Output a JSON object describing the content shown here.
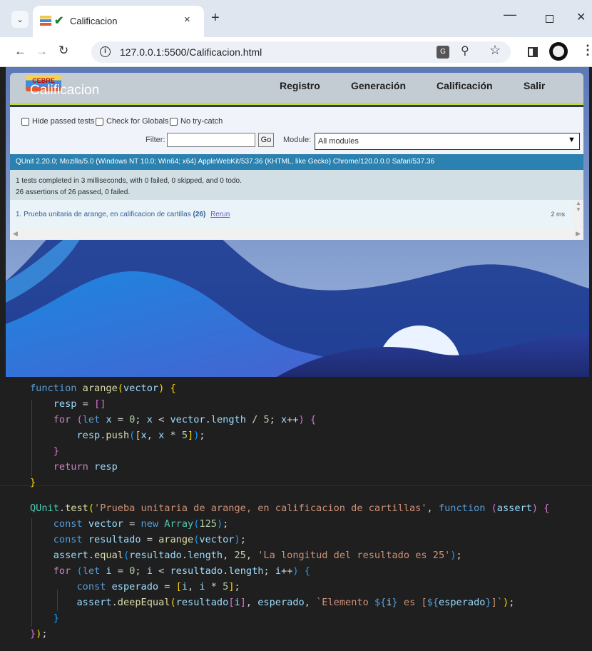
{
  "browser": {
    "tab_title": "Calificacion",
    "tab_close": "×",
    "new_tab": "+",
    "url": "127.0.0.1:5500/Calificacion.html",
    "window": {
      "minimize": "—",
      "close": "✕"
    }
  },
  "app": {
    "logo_text": "CEBRE",
    "brand": "Calificacion",
    "nav": [
      "Registro",
      "Generación",
      "Calificación",
      "Salir"
    ]
  },
  "qunit": {
    "checkboxes": [
      "Hide passed tests",
      "Check for Globals",
      "No try-catch"
    ],
    "filter_label": "Filter:",
    "filter_value": "",
    "go_label": "Go",
    "module_label": "Module:",
    "module_value": "All modules",
    "user_agent": "QUnit 2.20.0; Mozilla/5.0 (Windows NT 10.0; Win64; x64) AppleWebKit/537.36 (KHTML, like Gecko) Chrome/120.0.0.0 Safari/537.36",
    "result_line1": "1 tests completed in 3 milliseconds, with 0 failed, 0 skipped, and 0 todo.",
    "result_line2": "26 assertions of 26 passed, 0 failed.",
    "test_name": "1. Prueba unitaria de arange, en calificacion de cartillas",
    "test_count": "(26)",
    "rerun": "Rerun",
    "duration": "2 ms"
  },
  "code": {
    "lines": [
      "function arange(vector) {",
      "    resp = []",
      "    for (let x = 0; x < vector.length / 5; x++) {",
      "        resp.push([x, x * 5]);",
      "    }",
      "    return resp",
      "}",
      "QUnit.test('Prueba unitaria de arange, en calificacion de cartillas', function (assert) {",
      "    const vector = new Array(125);",
      "    const resultado = arange(vector);",
      "    assert.equal(resultado.length, 25, 'La longitud del resultado es 25');",
      "    for (let i = 0; i < resultado.length; i++) {",
      "        const esperado = [i, i * 5];",
      "        assert.deepEqual(resultado[i], esperado, `Elemento ${i} es [${esperado}]`);",
      "    }",
      "});"
    ]
  },
  "colors": {
    "accent": "#2b81af",
    "editor_bg": "#1f1f1f",
    "sky": "#6a88bf"
  }
}
